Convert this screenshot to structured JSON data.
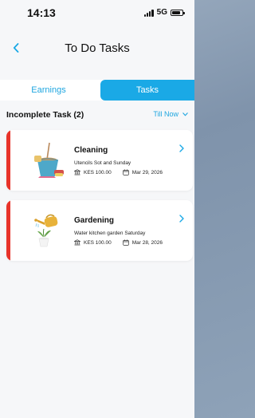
{
  "status_bar": {
    "time": "14:13",
    "network": "5G"
  },
  "nav": {
    "title": "To Do Tasks"
  },
  "segment": {
    "earnings_label": "Earnings",
    "tasks_label": "Tasks",
    "active": "Tasks"
  },
  "section": {
    "title": "Incomplete Task (2)",
    "filter_label": "Till Now"
  },
  "tasks": [
    {
      "title": "Cleaning",
      "description": "Utencils Sot and Sunday",
      "amount": "KES 100.00",
      "date": "Mar 29, 2026",
      "icon": "cleaning-bucket-icon"
    },
    {
      "title": "Gardening",
      "description": "Water kitchen garden Saturday",
      "amount": "KES 100.00",
      "date": "Mar 28, 2026",
      "icon": "watering-can-icon"
    }
  ],
  "colors": {
    "accent": "#1aa9e6",
    "urgent": "#e8332a"
  }
}
